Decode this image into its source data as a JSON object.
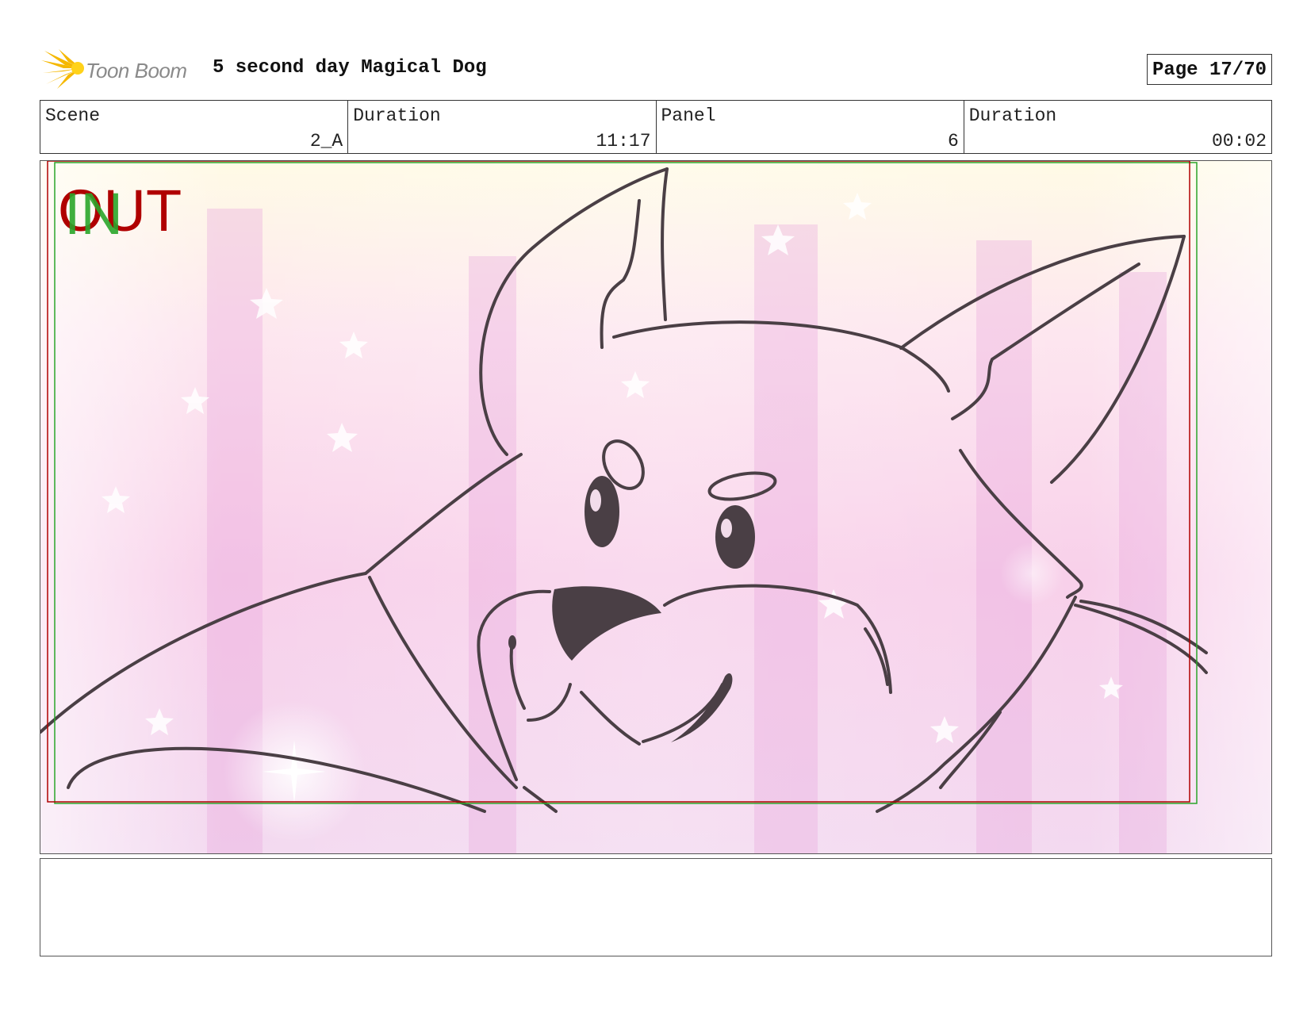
{
  "header": {
    "logo_text": "Toon Boom",
    "title": "5 second day Magical Dog",
    "page": "Page 17/70"
  },
  "info": [
    {
      "label": "Scene",
      "value": "2_A"
    },
    {
      "label": "Duration",
      "value": "11:17"
    },
    {
      "label": "Panel",
      "value": "6"
    },
    {
      "label": "Duration",
      "value": "00:02"
    }
  ],
  "panel": {
    "in_marker": "IN",
    "out_marker": "OUT",
    "in_color": "#2aa52a",
    "out_color": "#b00000"
  },
  "notes": {
    "text": ""
  }
}
